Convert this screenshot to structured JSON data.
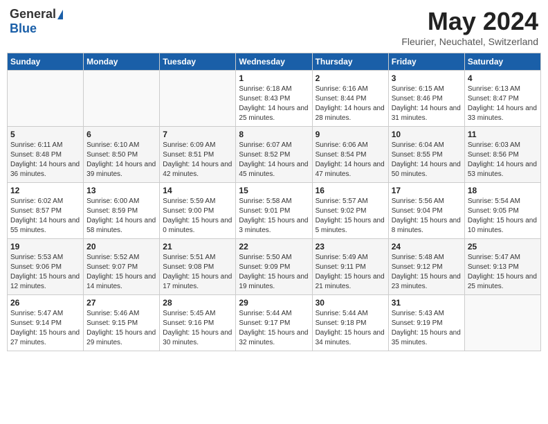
{
  "header": {
    "logo_general": "General",
    "logo_blue": "Blue",
    "month": "May 2024",
    "location": "Fleurier, Neuchatel, Switzerland"
  },
  "weekdays": [
    "Sunday",
    "Monday",
    "Tuesday",
    "Wednesday",
    "Thursday",
    "Friday",
    "Saturday"
  ],
  "weeks": [
    [
      {
        "day": "",
        "info": ""
      },
      {
        "day": "",
        "info": ""
      },
      {
        "day": "",
        "info": ""
      },
      {
        "day": "1",
        "info": "Sunrise: 6:18 AM\nSunset: 8:43 PM\nDaylight: 14 hours and 25 minutes."
      },
      {
        "day": "2",
        "info": "Sunrise: 6:16 AM\nSunset: 8:44 PM\nDaylight: 14 hours and 28 minutes."
      },
      {
        "day": "3",
        "info": "Sunrise: 6:15 AM\nSunset: 8:46 PM\nDaylight: 14 hours and 31 minutes."
      },
      {
        "day": "4",
        "info": "Sunrise: 6:13 AM\nSunset: 8:47 PM\nDaylight: 14 hours and 33 minutes."
      }
    ],
    [
      {
        "day": "5",
        "info": "Sunrise: 6:11 AM\nSunset: 8:48 PM\nDaylight: 14 hours and 36 minutes."
      },
      {
        "day": "6",
        "info": "Sunrise: 6:10 AM\nSunset: 8:50 PM\nDaylight: 14 hours and 39 minutes."
      },
      {
        "day": "7",
        "info": "Sunrise: 6:09 AM\nSunset: 8:51 PM\nDaylight: 14 hours and 42 minutes."
      },
      {
        "day": "8",
        "info": "Sunrise: 6:07 AM\nSunset: 8:52 PM\nDaylight: 14 hours and 45 minutes."
      },
      {
        "day": "9",
        "info": "Sunrise: 6:06 AM\nSunset: 8:54 PM\nDaylight: 14 hours and 47 minutes."
      },
      {
        "day": "10",
        "info": "Sunrise: 6:04 AM\nSunset: 8:55 PM\nDaylight: 14 hours and 50 minutes."
      },
      {
        "day": "11",
        "info": "Sunrise: 6:03 AM\nSunset: 8:56 PM\nDaylight: 14 hours and 53 minutes."
      }
    ],
    [
      {
        "day": "12",
        "info": "Sunrise: 6:02 AM\nSunset: 8:57 PM\nDaylight: 14 hours and 55 minutes."
      },
      {
        "day": "13",
        "info": "Sunrise: 6:00 AM\nSunset: 8:59 PM\nDaylight: 14 hours and 58 minutes."
      },
      {
        "day": "14",
        "info": "Sunrise: 5:59 AM\nSunset: 9:00 PM\nDaylight: 15 hours and 0 minutes."
      },
      {
        "day": "15",
        "info": "Sunrise: 5:58 AM\nSunset: 9:01 PM\nDaylight: 15 hours and 3 minutes."
      },
      {
        "day": "16",
        "info": "Sunrise: 5:57 AM\nSunset: 9:02 PM\nDaylight: 15 hours and 5 minutes."
      },
      {
        "day": "17",
        "info": "Sunrise: 5:56 AM\nSunset: 9:04 PM\nDaylight: 15 hours and 8 minutes."
      },
      {
        "day": "18",
        "info": "Sunrise: 5:54 AM\nSunset: 9:05 PM\nDaylight: 15 hours and 10 minutes."
      }
    ],
    [
      {
        "day": "19",
        "info": "Sunrise: 5:53 AM\nSunset: 9:06 PM\nDaylight: 15 hours and 12 minutes."
      },
      {
        "day": "20",
        "info": "Sunrise: 5:52 AM\nSunset: 9:07 PM\nDaylight: 15 hours and 14 minutes."
      },
      {
        "day": "21",
        "info": "Sunrise: 5:51 AM\nSunset: 9:08 PM\nDaylight: 15 hours and 17 minutes."
      },
      {
        "day": "22",
        "info": "Sunrise: 5:50 AM\nSunset: 9:09 PM\nDaylight: 15 hours and 19 minutes."
      },
      {
        "day": "23",
        "info": "Sunrise: 5:49 AM\nSunset: 9:11 PM\nDaylight: 15 hours and 21 minutes."
      },
      {
        "day": "24",
        "info": "Sunrise: 5:48 AM\nSunset: 9:12 PM\nDaylight: 15 hours and 23 minutes."
      },
      {
        "day": "25",
        "info": "Sunrise: 5:47 AM\nSunset: 9:13 PM\nDaylight: 15 hours and 25 minutes."
      }
    ],
    [
      {
        "day": "26",
        "info": "Sunrise: 5:47 AM\nSunset: 9:14 PM\nDaylight: 15 hours and 27 minutes."
      },
      {
        "day": "27",
        "info": "Sunrise: 5:46 AM\nSunset: 9:15 PM\nDaylight: 15 hours and 29 minutes."
      },
      {
        "day": "28",
        "info": "Sunrise: 5:45 AM\nSunset: 9:16 PM\nDaylight: 15 hours and 30 minutes."
      },
      {
        "day": "29",
        "info": "Sunrise: 5:44 AM\nSunset: 9:17 PM\nDaylight: 15 hours and 32 minutes."
      },
      {
        "day": "30",
        "info": "Sunrise: 5:44 AM\nSunset: 9:18 PM\nDaylight: 15 hours and 34 minutes."
      },
      {
        "day": "31",
        "info": "Sunrise: 5:43 AM\nSunset: 9:19 PM\nDaylight: 15 hours and 35 minutes."
      },
      {
        "day": "",
        "info": ""
      }
    ]
  ]
}
